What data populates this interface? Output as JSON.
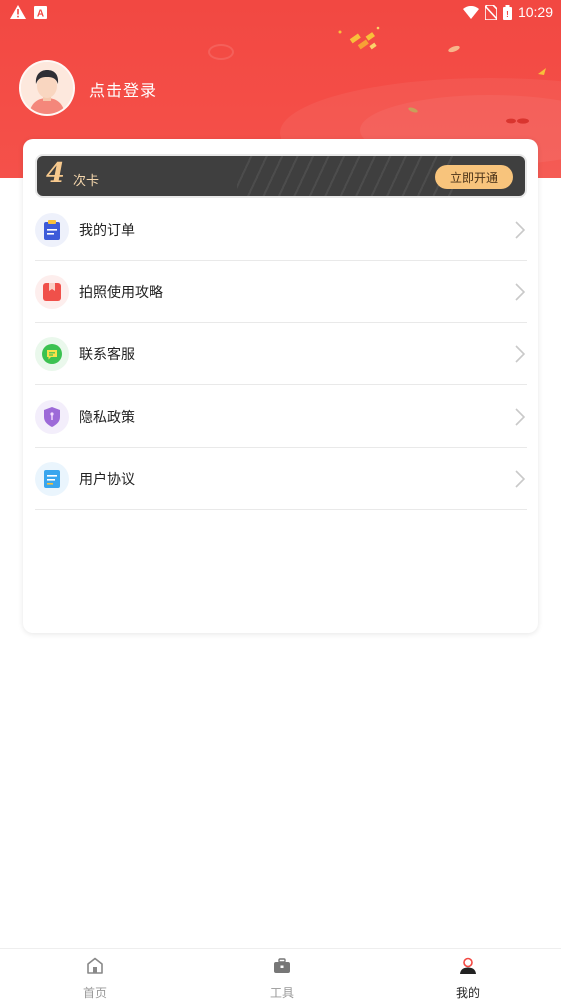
{
  "status_bar": {
    "time": "10:29",
    "icons": [
      "warning-icon",
      "app-a-icon",
      "wifi-icon",
      "no-sim-icon",
      "battery-icon"
    ]
  },
  "profile": {
    "login_text": "点击登录",
    "avatar_icon": "user-avatar"
  },
  "vip_card": {
    "count": "4",
    "unit": "次卡",
    "button_label": "立即开通"
  },
  "menu": {
    "items": [
      {
        "label": "我的订单",
        "icon": "order-clipboard-icon",
        "color": "#3d5bd9"
      },
      {
        "label": "拍照使用攻略",
        "icon": "guide-bookmark-icon",
        "color": "#f0504a"
      },
      {
        "label": "联系客服",
        "icon": "chat-support-icon",
        "color": "#3cc251"
      },
      {
        "label": "隐私政策",
        "icon": "shield-privacy-icon",
        "color": "#9d6ad8"
      },
      {
        "label": "用户协议",
        "icon": "document-agreement-icon",
        "color": "#3aa6ee"
      }
    ]
  },
  "tabbar": {
    "tabs": [
      {
        "label": "首页",
        "icon": "home-icon",
        "active": false
      },
      {
        "label": "工具",
        "icon": "toolbox-icon",
        "active": false
      },
      {
        "label": "我的",
        "icon": "profile-icon",
        "active": true
      }
    ]
  },
  "colors": {
    "header_red": "#f24842",
    "vip_gold": "#f8c47c",
    "active_tab_red": "#f24842"
  }
}
